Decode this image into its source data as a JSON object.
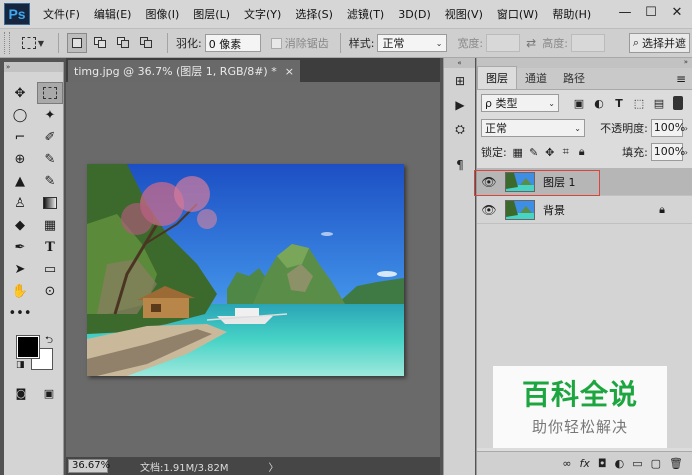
{
  "app": {
    "logo": "Ps",
    "menu": [
      "文件(F)",
      "编辑(E)",
      "图像(I)",
      "图层(L)",
      "文字(Y)",
      "选择(S)",
      "滤镜(T)",
      "3D(D)",
      "视图(V)",
      "窗口(W)",
      "帮助(H)"
    ],
    "window_controls": {
      "minimize": "—",
      "maximize": "☐",
      "close": "✕"
    }
  },
  "options_bar": {
    "feather_label": "羽化:",
    "feather_value": "0 像素",
    "antialias_label": "消除锯齿",
    "style_label": "样式:",
    "style_value": "正常",
    "width_label": "宽度:",
    "height_label": "高度:",
    "select_subject": "选择并遮"
  },
  "toolbar": {
    "tools": [
      "✥",
      "⬚",
      "◯",
      "✦",
      "⌐",
      "✐",
      "⊕",
      "✎",
      "▲",
      "✎",
      "♙",
      "⇗",
      "◆",
      "▦",
      "♦",
      "◉",
      "✒",
      "T",
      "➤",
      "▭",
      "✋",
      "⊙",
      "•••",
      ""
    ]
  },
  "document": {
    "tab_title": "timg.jpg @ 36.7% (图层 1, RGB/8#) *",
    "tab_close": "×",
    "zoom": "36.67%",
    "doc_info": "文档:1.91M/3.82M",
    "status_arrow": "〉"
  },
  "layers_panel": {
    "tabs": [
      "图层",
      "通道",
      "路径"
    ],
    "menu_icon": "≡",
    "filter_label": "ρ 类型",
    "blend_mode": "正常",
    "opacity_label": "不透明度:",
    "opacity_value": "100%",
    "lock_label": "锁定:",
    "fill_label": "填充:",
    "fill_value": "100%",
    "layers": [
      {
        "name": "图层 1",
        "visible": true,
        "selected": true,
        "locked": false
      },
      {
        "name": "背景",
        "visible": true,
        "selected": false,
        "locked": true
      }
    ],
    "footer_icons": [
      "∞",
      "fx",
      "◘",
      "◐",
      "▭",
      "▢",
      "🗑"
    ]
  },
  "watermark": {
    "title": "百科全说",
    "subtitle": "助你轻松解决"
  },
  "colors": {
    "menu_bg": "#d6d6d6",
    "canvas_bg": "#6a6a6a",
    "panel_bg": "#dcdcdc",
    "highlight": "#d9443c",
    "watermark_green": "#1da53f"
  }
}
